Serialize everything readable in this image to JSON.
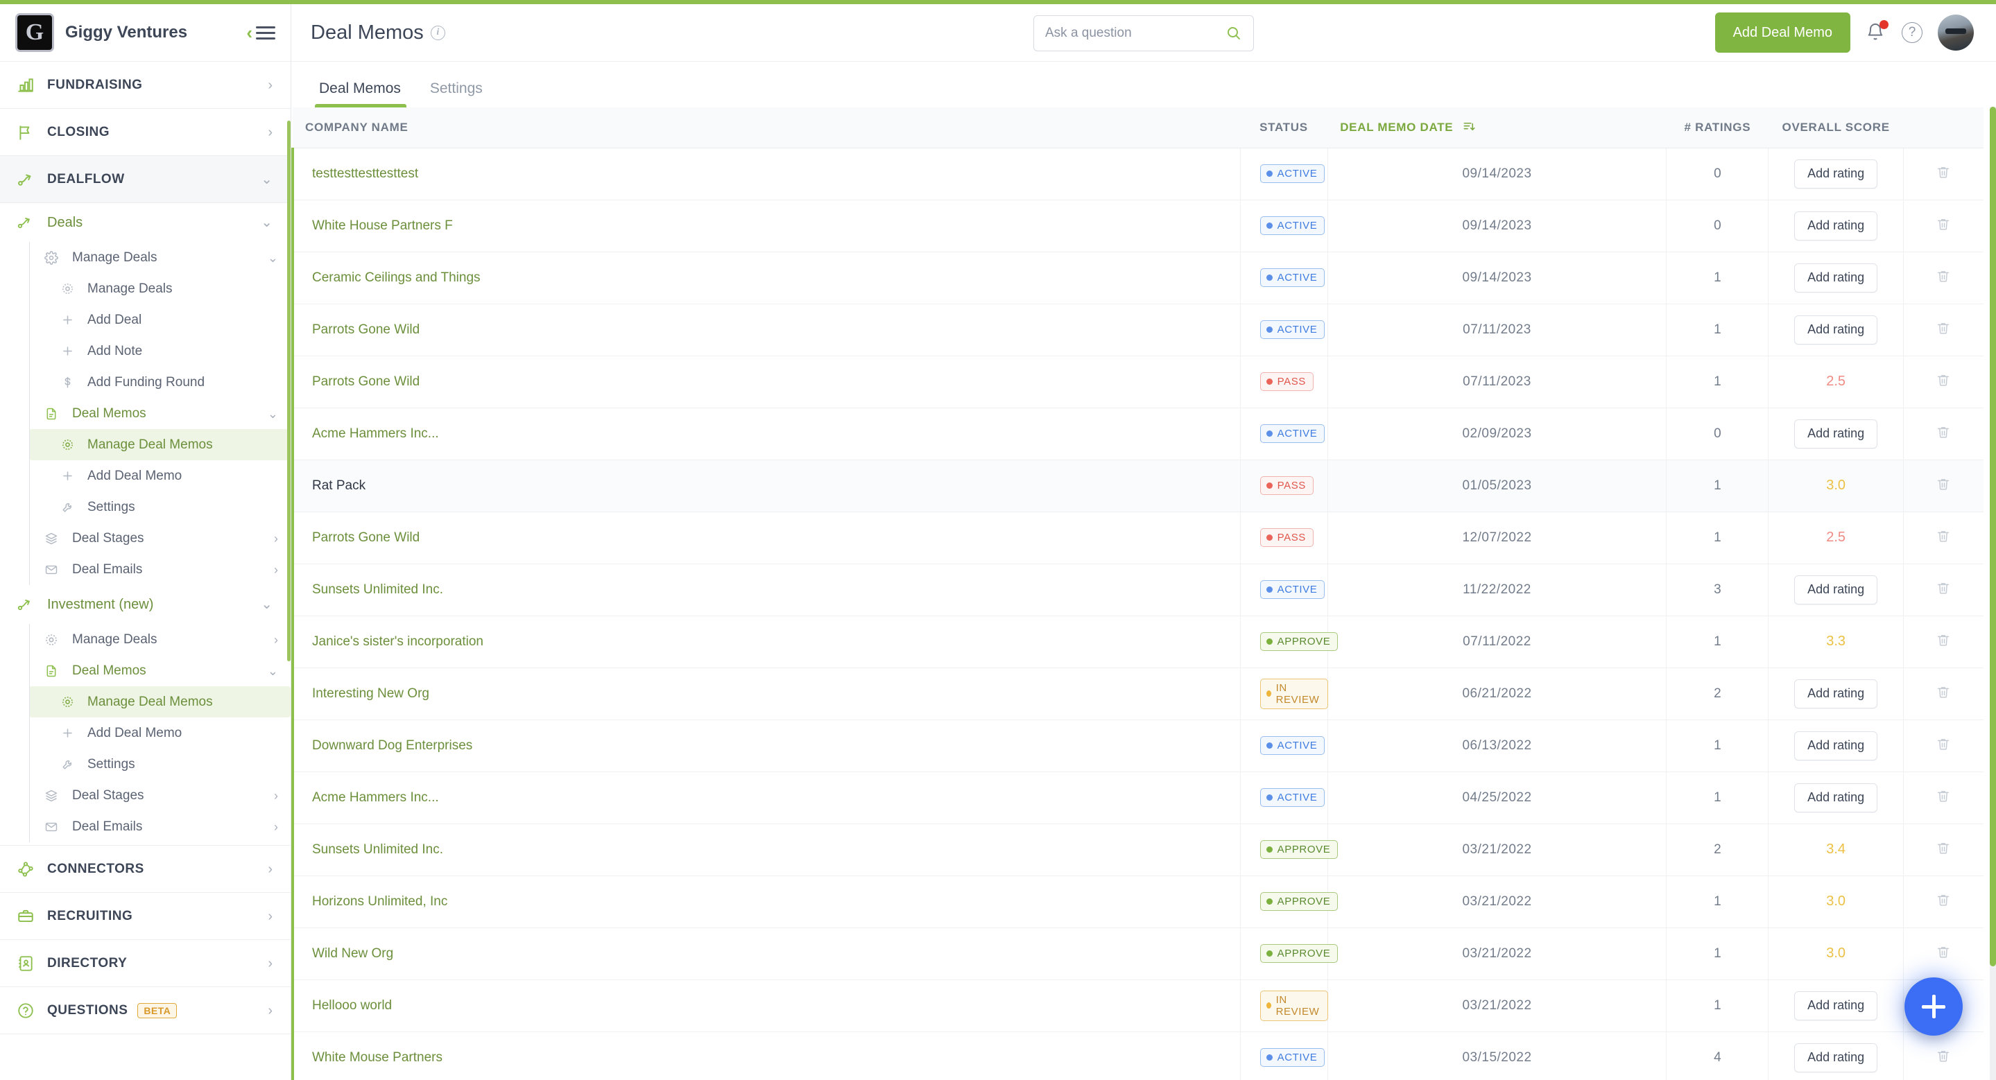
{
  "brand": {
    "name": "Giggy Ventures",
    "logo_letter": "G"
  },
  "sidebar": {
    "sections": [
      {
        "label": "FUNDRAISING",
        "icon": "bar-chart-icon"
      },
      {
        "label": "CLOSING",
        "icon": "flag-icon"
      },
      {
        "label": "DEALFLOW",
        "icon": "deal-flow-icon",
        "expanded": true
      },
      {
        "label": "CONNECTORS",
        "icon": "network-icon"
      },
      {
        "label": "RECRUITING",
        "icon": "briefcase-icon"
      },
      {
        "label": "DIRECTORY",
        "icon": "address-book-icon"
      },
      {
        "label": "QUESTIONS",
        "icon": "question-circle-icon",
        "badge": "BETA"
      }
    ],
    "dealflow": {
      "groups": [
        {
          "label": "Deals",
          "icon": "deal-flow-icon",
          "children": [
            {
              "label": "Manage Deals",
              "icon": "gear-icon",
              "expandable": true,
              "expanded": true,
              "children": [
                {
                  "label": "Manage Deals",
                  "icon": "gear-icon"
                },
                {
                  "label": "Add Deal",
                  "icon": "plus-icon"
                },
                {
                  "label": "Add Note",
                  "icon": "plus-icon"
                },
                {
                  "label": "Add Funding Round",
                  "icon": "dollar-icon"
                }
              ]
            },
            {
              "label": "Deal Memos",
              "icon": "document-icon",
              "green": true,
              "expandable": true,
              "expanded": true,
              "children": [
                {
                  "label": "Manage Deal Memos",
                  "icon": "gear-icon",
                  "selected": true
                },
                {
                  "label": "Add Deal Memo",
                  "icon": "plus-icon"
                },
                {
                  "label": "Settings",
                  "icon": "wrench-icon"
                }
              ]
            },
            {
              "label": "Deal Stages",
              "icon": "layers-icon",
              "expandable": true
            },
            {
              "label": "Deal Emails",
              "icon": "envelope-icon",
              "expandable": true
            }
          ]
        },
        {
          "label": "Investment (new)",
          "icon": "deal-flow-icon",
          "children": [
            {
              "label": "Manage Deals",
              "icon": "gear-icon",
              "expandable": true
            },
            {
              "label": "Deal Memos",
              "icon": "document-icon",
              "green": true,
              "expandable": true,
              "expanded": true,
              "children": [
                {
                  "label": "Manage Deal Memos",
                  "icon": "gear-icon",
                  "selected": true
                },
                {
                  "label": "Add Deal Memo",
                  "icon": "plus-icon"
                },
                {
                  "label": "Settings",
                  "icon": "wrench-icon"
                }
              ]
            },
            {
              "label": "Deal Stages",
              "icon": "layers-icon",
              "expandable": true
            },
            {
              "label": "Deal Emails",
              "icon": "envelope-icon",
              "expandable": true
            }
          ]
        }
      ]
    }
  },
  "header": {
    "title": "Deal Memos",
    "info_icon": "info-icon",
    "add_button": "Add Deal Memo",
    "notifications_icon": "bell-icon",
    "help_icon": "question-circle-icon",
    "avatar_icon": "user-avatar"
  },
  "search": {
    "placeholder": "Ask a question",
    "value": "",
    "icon": "search-icon"
  },
  "tabs": [
    {
      "label": "Deal Memos",
      "active": true
    },
    {
      "label": "Settings",
      "active": false
    }
  ],
  "table": {
    "columns": [
      "COMPANY NAME",
      "STATUS",
      "DEAL MEMO DATE",
      "# RATINGS",
      "OVERALL SCORE"
    ],
    "sorted_column": "DEAL MEMO DATE",
    "sort_direction": "desc",
    "add_rating_label": "Add rating",
    "delete_icon": "trash-icon",
    "rows": [
      {
        "company": "testtesttesttesttest",
        "status": "ACTIVE",
        "date": "09/14/2023",
        "ratings": "0",
        "score": null,
        "score_tone": null
      },
      {
        "company": "White House Partners F",
        "status": "ACTIVE",
        "date": "09/14/2023",
        "ratings": "0",
        "score": null,
        "score_tone": null
      },
      {
        "company": "Ceramic Ceilings and Things",
        "status": "ACTIVE",
        "date": "09/14/2023",
        "ratings": "1",
        "score": null,
        "score_tone": null
      },
      {
        "company": "Parrots Gone Wild",
        "status": "ACTIVE",
        "date": "07/11/2023",
        "ratings": "1",
        "score": null,
        "score_tone": null
      },
      {
        "company": "Parrots Gone Wild",
        "status": "PASS",
        "date": "07/11/2023",
        "ratings": "1",
        "score": "2.5",
        "score_tone": "low"
      },
      {
        "company": "Acme Hammers Inc...",
        "status": "ACTIVE",
        "date": "02/09/2023",
        "ratings": "0",
        "score": null,
        "score_tone": null
      },
      {
        "company": "Rat Pack",
        "status": "PASS",
        "date": "01/05/2023",
        "ratings": "1",
        "score": "3.0",
        "score_tone": "mid",
        "highlight": true,
        "dark_name": true
      },
      {
        "company": "Parrots Gone Wild",
        "status": "PASS",
        "date": "12/07/2022",
        "ratings": "1",
        "score": "2.5",
        "score_tone": "low"
      },
      {
        "company": "Sunsets Unlimited Inc.",
        "status": "ACTIVE",
        "date": "11/22/2022",
        "ratings": "3",
        "score": null,
        "score_tone": null
      },
      {
        "company": "Janice's sister's incorporation",
        "status": "APPROVE",
        "date": "07/11/2022",
        "ratings": "1",
        "score": "3.3",
        "score_tone": "mid"
      },
      {
        "company": "Interesting New Org",
        "status": "IN REVIEW",
        "date": "06/21/2022",
        "ratings": "2",
        "score": null,
        "score_tone": null
      },
      {
        "company": "Downward Dog Enterprises",
        "status": "ACTIVE",
        "date": "06/13/2022",
        "ratings": "1",
        "score": null,
        "score_tone": null
      },
      {
        "company": "Acme Hammers Inc...",
        "status": "ACTIVE",
        "date": "04/25/2022",
        "ratings": "1",
        "score": null,
        "score_tone": null
      },
      {
        "company": "Sunsets Unlimited Inc.",
        "status": "APPROVE",
        "date": "03/21/2022",
        "ratings": "2",
        "score": "3.4",
        "score_tone": "mid"
      },
      {
        "company": "Horizons Unlimited, Inc",
        "status": "APPROVE",
        "date": "03/21/2022",
        "ratings": "1",
        "score": "3.0",
        "score_tone": "mid"
      },
      {
        "company": "Wild New Org",
        "status": "APPROVE",
        "date": "03/21/2022",
        "ratings": "1",
        "score": "3.0",
        "score_tone": "mid"
      },
      {
        "company": "Hellooo world",
        "status": "IN REVIEW",
        "date": "03/21/2022",
        "ratings": "1",
        "score": null,
        "score_tone": null
      },
      {
        "company": "White Mouse Partners",
        "status": "ACTIVE",
        "date": "03/15/2022",
        "ratings": "4",
        "score": null,
        "score_tone": null
      }
    ]
  },
  "fab": {
    "icon": "plus-icon"
  },
  "colors": {
    "accent_green": "#8cbf4c",
    "link_green": "#6c8f3c",
    "primary_button": "#80b541",
    "fab_blue": "#3b6ef5",
    "status_active": "#3e7ce0",
    "status_pass": "#e0564c",
    "status_approve": "#5b8a2e",
    "status_review": "#c2892c",
    "score_low": "#ef8b83",
    "score_mid": "#edc044"
  }
}
